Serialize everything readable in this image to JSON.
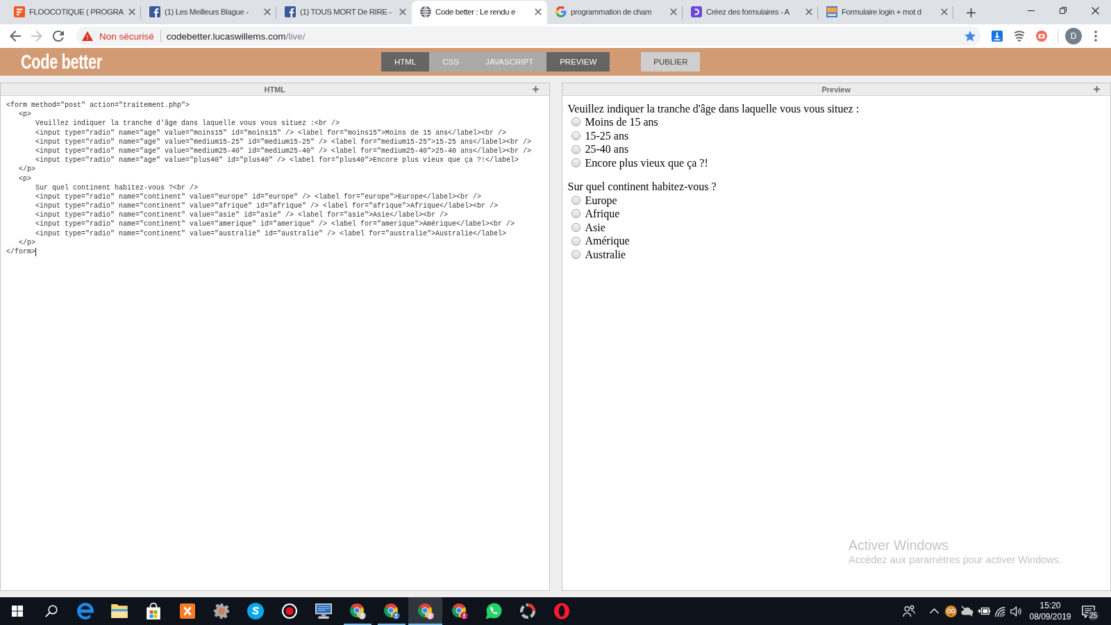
{
  "browser": {
    "tabs": [
      {
        "title": "FLOOCOTIQUE ( PROGRA",
        "selected": false
      },
      {
        "title": "(1) Les Meilleurs Blague -",
        "selected": false
      },
      {
        "title": "(1) TOUS MORT De RIRE -",
        "selected": false
      },
      {
        "title": "Code better : Le rendu e",
        "selected": true
      },
      {
        "title": "programmation de cham",
        "selected": false
      },
      {
        "title": "Créez des formulaires - A",
        "selected": false
      },
      {
        "title": "Formulaire login + mot d",
        "selected": false
      }
    ],
    "nav_buttons": [
      {
        "kind": "back",
        "disabled": false
      },
      {
        "kind": "forward",
        "disabled": true
      },
      {
        "kind": "reload",
        "disabled": false
      }
    ],
    "address_bar": {
      "security_label": "Non sécurisé",
      "url_host": "codebetter.lucaswillems.com",
      "url_path": "/live/",
      "bookmarked": true
    },
    "profile_initial": "D"
  },
  "app": {
    "logo": "Code better",
    "view_tabs": [
      {
        "label": "HTML",
        "selected": true
      },
      {
        "label": "CSS",
        "selected": false
      },
      {
        "label": "JAVASCRIPT",
        "selected": false
      },
      {
        "label": "PREVIEW",
        "selected": true
      }
    ],
    "publish_button": "PUBLIER",
    "panels": [
      {
        "kind": "code",
        "title": "HTML",
        "lines": [
          "<form method=\"post\" action=\"traitement.php\">",
          "   <p>",
          "       Veuillez indiquer la tranche d'âge dans laquelle vous vous situez :<br />",
          "       <input type=\"radio\" name=\"age\" value=\"moins15\" id=\"moins15\" /> <label for=\"moins15\">Moins de 15 ans</label><br />",
          "       <input type=\"radio\" name=\"age\" value=\"medium15-25\" id=\"medium15-25\" /> <label for=\"medium15-25\">15-25 ans</label><br />",
          "       <input type=\"radio\" name=\"age\" value=\"medium25-40\" id=\"medium25-40\" /> <label for=\"medium25-40\">25-40 ans</label><br />",
          "       <input type=\"radio\" name=\"age\" value=\"plus40\" id=\"plus40\" /> <label for=\"plus40\">Encore plus vieux que ça ?!</label>",
          "   </p>",
          "   <p>",
          "       Sur quel continent habitez-vous ?<br />",
          "       <input type=\"radio\" name=\"continent\" value=\"europe\" id=\"europe\" /> <label for=\"europe\">Europe</label><br />",
          "       <input type=\"radio\" name=\"continent\" value=\"afrique\" id=\"afrique\" /> <label for=\"afrique\">Afrique</label><br />",
          "       <input type=\"radio\" name=\"continent\" value=\"asie\" id=\"asie\" /> <label for=\"asie\">Asie</label><br />",
          "       <input type=\"radio\" name=\"continent\" value=\"amerique\" id=\"amerique\" /> <label for=\"amerique\">Amérique</label><br />",
          "       <input type=\"radio\" name=\"continent\" value=\"australie\" id=\"australie\" /> <label for=\"australie\">Australie</label>",
          "   </p>",
          "</form>"
        ]
      },
      {
        "kind": "preview",
        "title": "Preview",
        "groups": [
          {
            "question": "Veuillez indiquer la tranche d'âge dans laquelle vous vous situez :",
            "options": [
              {
                "label": "Moins de 15 ans",
                "selected": false
              },
              {
                "label": "15-25 ans",
                "selected": false
              },
              {
                "label": "25-40 ans",
                "selected": false
              },
              {
                "label": "Encore plus vieux que ça ?!",
                "selected": false
              }
            ]
          },
          {
            "question": "Sur quel continent habitez-vous ?",
            "options": [
              {
                "label": "Europe",
                "selected": false
              },
              {
                "label": "Afrique",
                "selected": false
              },
              {
                "label": "Asie",
                "selected": false
              },
              {
                "label": "Amérique",
                "selected": false
              },
              {
                "label": "Australie",
                "selected": false
              }
            ]
          }
        ]
      }
    ]
  },
  "activation_notice": {
    "title": "Activer Windows",
    "text": "Accédez aux paramètres pour activer Windows."
  },
  "taskbar": {
    "apps": [
      {
        "running": false,
        "selected": false
      },
      {
        "running": false,
        "selected": false
      },
      {
        "running": false,
        "selected": false
      },
      {
        "running": false,
        "selected": false
      },
      {
        "running": false,
        "selected": false
      },
      {
        "running": false,
        "selected": false
      },
      {
        "running": false,
        "selected": false
      },
      {
        "running": false,
        "selected": false
      },
      {
        "running": true,
        "selected": false
      },
      {
        "running": true,
        "selected": false
      },
      {
        "running": true,
        "selected": true
      },
      {
        "running": false,
        "selected": false
      },
      {
        "running": false,
        "selected": false
      },
      {
        "running": false,
        "selected": false
      },
      {
        "running": false,
        "selected": false
      }
    ],
    "clock": {
      "time": "15:20",
      "date": "08/09/2019"
    },
    "notification_count": "25"
  }
}
